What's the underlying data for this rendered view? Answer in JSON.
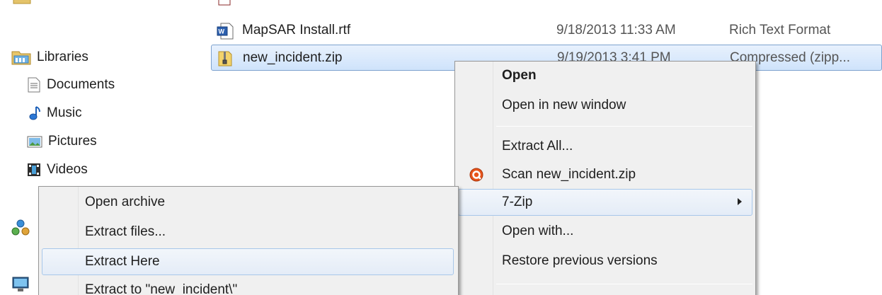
{
  "nav": {
    "items": [
      {
        "label": "Libraries",
        "icon": "libraries-icon"
      },
      {
        "label": "Documents",
        "icon": "documents-icon"
      },
      {
        "label": "Music",
        "icon": "music-icon"
      },
      {
        "label": "Pictures",
        "icon": "pictures-icon"
      },
      {
        "label": "Videos",
        "icon": "videos-icon"
      }
    ]
  },
  "files": [
    {
      "name": "MapSAR Install.rtf",
      "date": "9/18/2013 11:33 AM",
      "type": "Rich Text Format",
      "icon": "rtf-file-icon"
    },
    {
      "name": "new_incident.zip",
      "date": "9/19/2013 3:41 PM",
      "type": "Compressed (zipp...",
      "icon": "zip-file-icon"
    }
  ],
  "context_menu": {
    "items": [
      "Open",
      "Open in new window",
      "Extract All...",
      "Scan new_incident.zip",
      "7-Zip",
      "Open with...",
      "Restore previous versions"
    ]
  },
  "submenu_7zip": {
    "items": [
      "Open archive",
      "Extract files...",
      "Extract Here",
      "Extract to \"new_incident\\\""
    ]
  },
  "colors": {
    "selection_border": "#7da2ce",
    "menu_background": "#f0f0f0",
    "hover_border": "#a8c7ea",
    "scan_icon": "#e8541b"
  }
}
